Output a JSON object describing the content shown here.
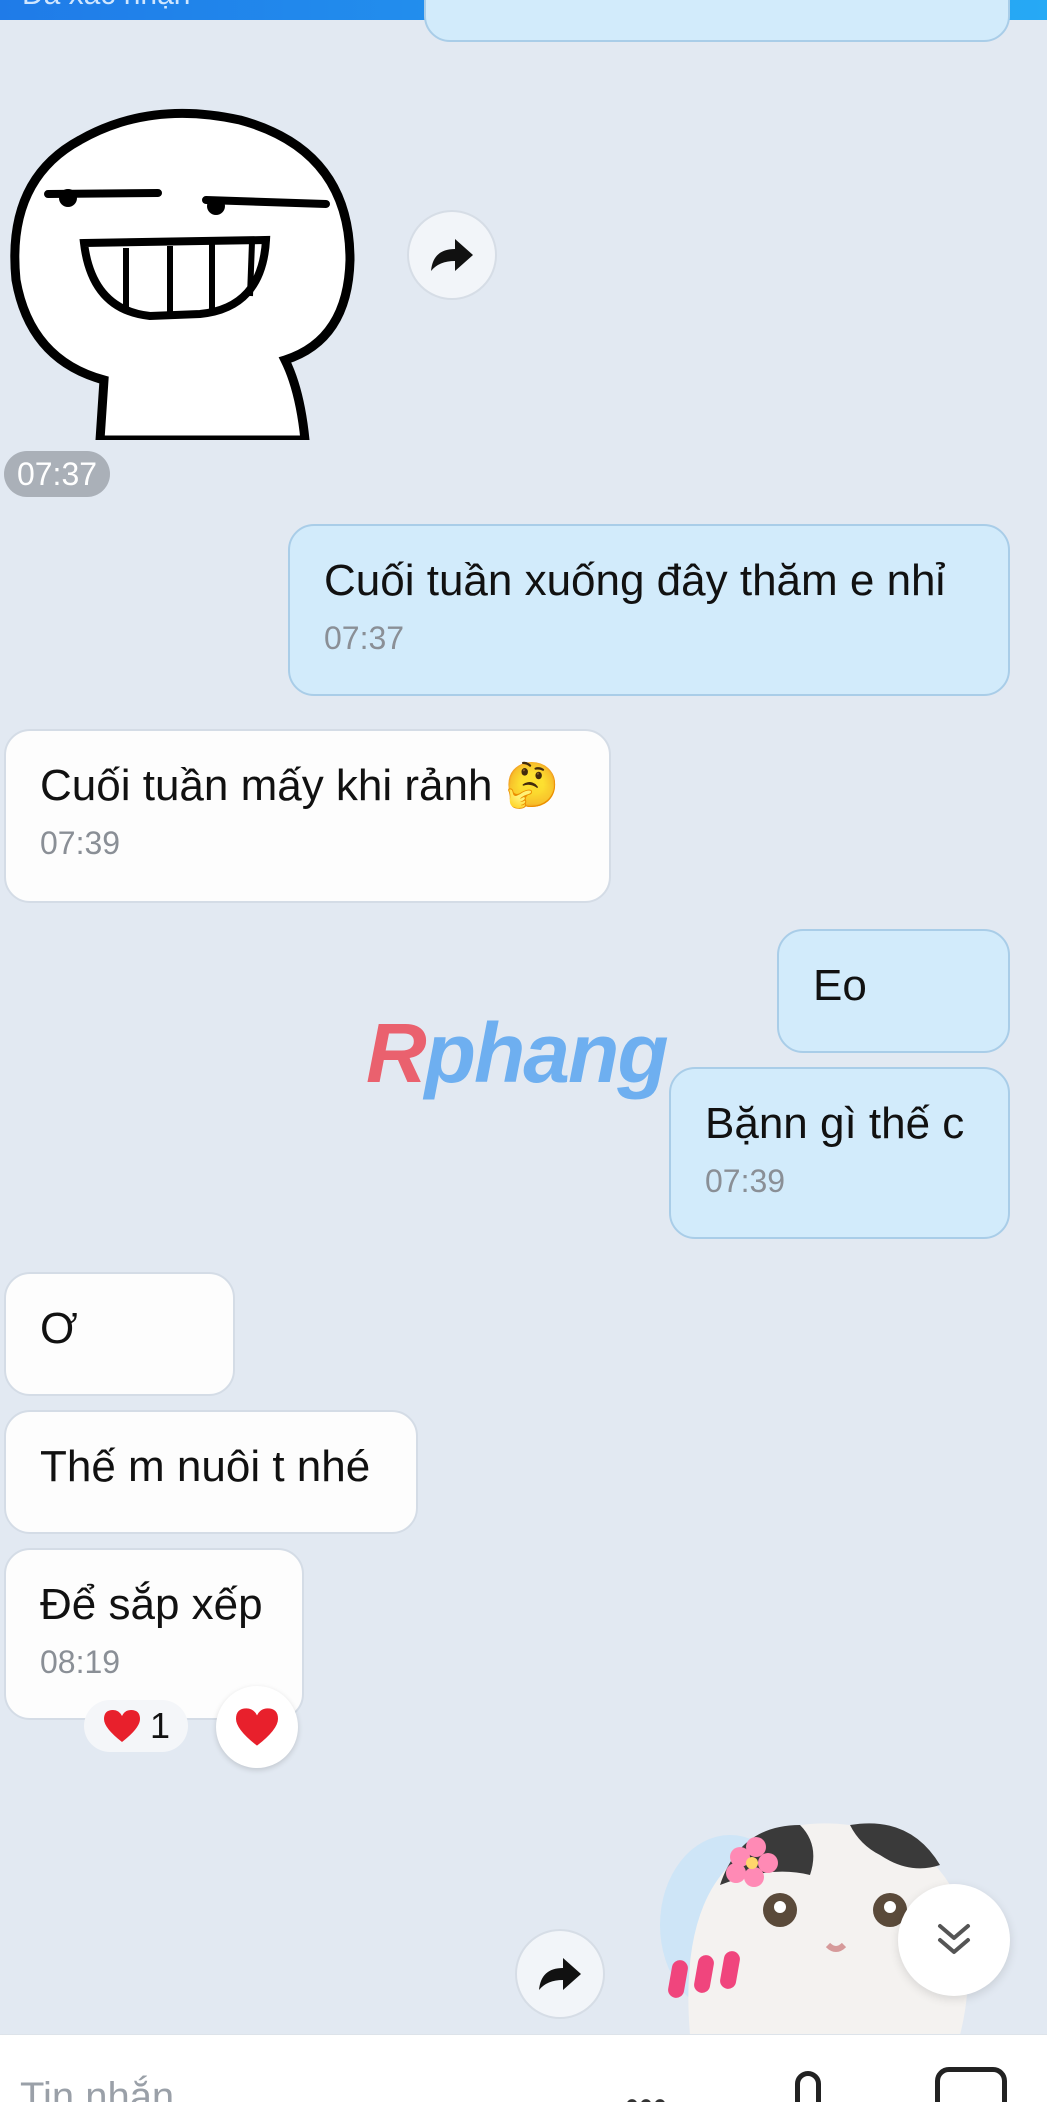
{
  "topbar": {
    "partial_text": "Đã xác nhận"
  },
  "messages": {
    "sticker_time": "07:37",
    "m1": {
      "text": "Cuối tuần xuống đây thăm e nhỉ",
      "time": "07:37"
    },
    "m2": {
      "text": "Cuối tuần mấy khi rảnh 🤔",
      "time": "07:39"
    },
    "m3": {
      "text": "Eo"
    },
    "m4": {
      "text": "Bặnn gì thế c",
      "time": "07:39"
    },
    "m5": {
      "text": "Ơ"
    },
    "m6": {
      "text": "Thế m nuôi t nhé"
    },
    "m7": {
      "text": "Để sắp xếp",
      "time": "08:19"
    }
  },
  "reactions": {
    "emoji": "❤️",
    "count": "1"
  },
  "watermark": {
    "r": "R",
    "rest": "phang"
  },
  "input": {
    "placeholder": "Tin nhắn"
  },
  "icons": {
    "forward": "forward-arrow-icon",
    "scroll": "double-chevron-down-icon",
    "heart": "heart-icon"
  }
}
